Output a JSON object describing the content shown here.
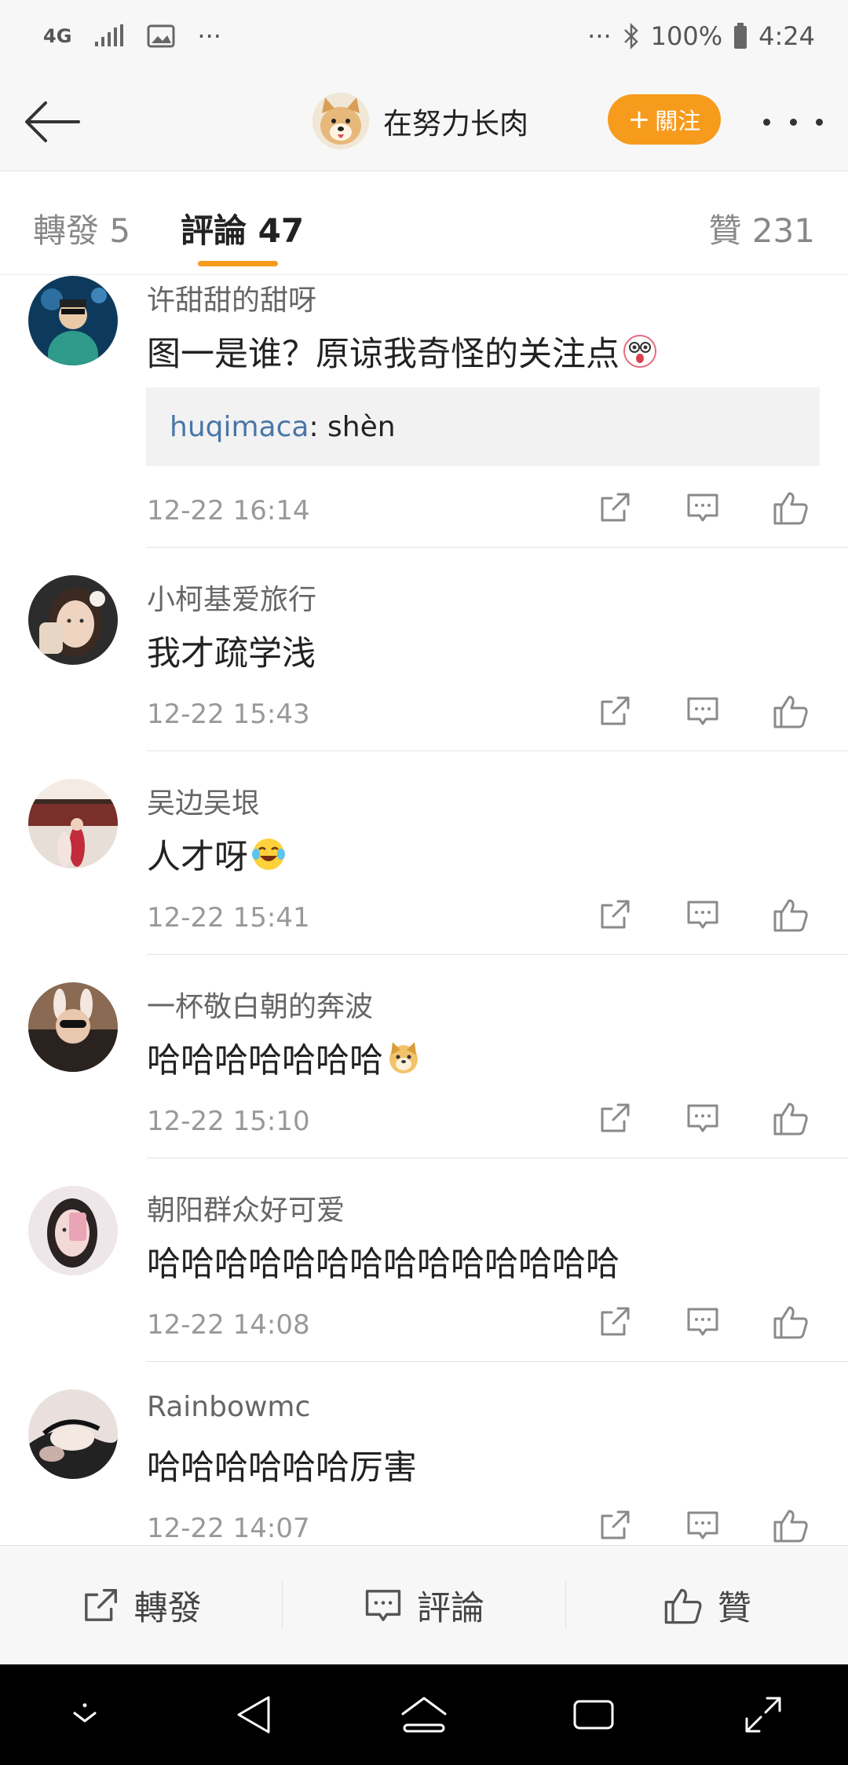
{
  "status_bar": {
    "network": "4G",
    "more": "···",
    "right_more": "···",
    "battery": "100%",
    "time": "4:24"
  },
  "header": {
    "profile_name": "在努力长肉",
    "follow_label": "關注",
    "follow_plus": "+"
  },
  "tabs": {
    "repost": "轉發 5",
    "comments": "評論 47",
    "likes": "贊 231"
  },
  "comments": [
    {
      "user": "许甜甜的甜呀",
      "text": "图一是谁？原谅我奇怪的关注点",
      "emoji": "shocked-emoji",
      "reply_user": "huqimaca",
      "reply_sep": ": ",
      "reply_text": "shèn",
      "time": "12-22 16:14"
    },
    {
      "user": "小柯基爱旅行",
      "text": "我才疏学浅",
      "time": "12-22 15:43"
    },
    {
      "user": "吴边吴垠",
      "text": "人才呀",
      "emoji": "laugh-cry-emoji",
      "time": "12-22 15:41"
    },
    {
      "user": "一杯敬白朝的奔波",
      "text": "哈哈哈哈哈哈哈",
      "emoji": "doge-emoji",
      "time": "12-22 15:10"
    },
    {
      "user": "朝阳群众好可爱",
      "text": "哈哈哈哈哈哈哈哈哈哈哈哈哈哈",
      "time": "12-22 14:08"
    },
    {
      "user": "Rainbowmc",
      "text": "哈哈哈哈哈哈厉害",
      "time": "12-22 14:07"
    }
  ],
  "bottom_bar": {
    "repost": "轉發",
    "comment": "評論",
    "like": "贊"
  },
  "colors": {
    "accent": "#f79b1c",
    "link": "#4a76a8",
    "icon": "#8a8a8a"
  }
}
